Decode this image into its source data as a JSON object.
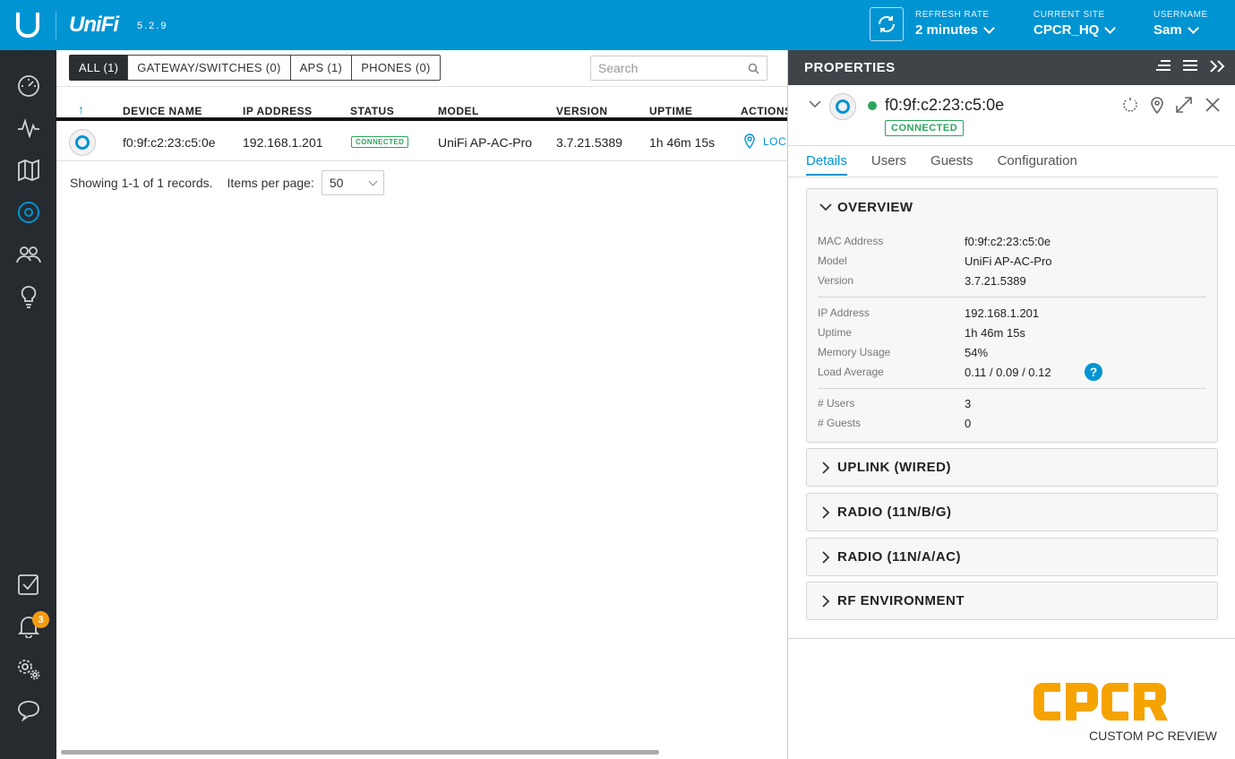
{
  "app": {
    "brand": "UniFi",
    "version": "5.2.9"
  },
  "header": {
    "refresh": {
      "label": "REFRESH RATE",
      "value": "2 minutes"
    },
    "site": {
      "label": "CURRENT SITE",
      "value": "CPCR_HQ"
    },
    "user": {
      "label": "USERNAME",
      "value": "Sam"
    }
  },
  "sidebar": {
    "items": [
      "dashboard-icon",
      "statistics-icon",
      "map-icon",
      "devices-icon",
      "clients-icon",
      "insights-icon"
    ],
    "bottom_items": [
      "events-icon",
      "alerts-icon",
      "settings-icon",
      "support-chat-icon"
    ],
    "alert_count": "3",
    "active_color": "#0194d3"
  },
  "devices": {
    "filters": [
      "ALL (1)",
      "GATEWAY/SWITCHES (0)",
      "APS (1)",
      "PHONES (0)"
    ],
    "search_placeholder": "Search",
    "columns": [
      "DEVICE NAME",
      "IP ADDRESS",
      "STATUS",
      "MODEL",
      "VERSION",
      "UPTIME",
      "ACTIONS"
    ],
    "rows": [
      {
        "name": "f0:9f:c2:23:c5:0e",
        "ip": "192.168.1.201",
        "status": "CONNECTED",
        "model": "UniFi AP-AC-Pro",
        "version": "3.7.21.5389",
        "uptime": "1h 46m 15s",
        "action": "LOC"
      }
    ],
    "showing": "Showing 1-1 of 1 records.",
    "items_per_page_label": "Items per page:",
    "items_per_page": "50"
  },
  "properties": {
    "title": "PROPERTIES",
    "device_name": "f0:9f:c2:23:c5:0e",
    "status": "CONNECTED",
    "status_color": "#2ca55c",
    "tabs": [
      "Details",
      "Users",
      "Guests",
      "Configuration"
    ],
    "active_tab": "Details",
    "overview": {
      "title": "OVERVIEW",
      "rows": [
        {
          "k": "MAC Address",
          "v": "f0:9f:c2:23:c5:0e"
        },
        {
          "k": "Model",
          "v": "UniFi AP-AC-Pro"
        },
        {
          "k": "Version",
          "v": "3.7.21.5389"
        },
        {
          "k": "IP Address",
          "v": "192.168.1.201"
        },
        {
          "k": "Uptime",
          "v": "1h 46m 15s"
        },
        {
          "k": "Memory Usage",
          "v": "54%"
        },
        {
          "k": "Load Average",
          "v": "0.11 / 0.09 / 0.12"
        },
        {
          "k": "# Users",
          "v": "3"
        },
        {
          "k": "# Guests",
          "v": "0"
        }
      ]
    },
    "sections": [
      "UPLINK (WIRED)",
      "RADIO (11N/B/G)",
      "RADIO (11N/A/AC)",
      "RF ENVIRONMENT"
    ]
  },
  "watermark": {
    "logo": "CPCR",
    "caption": "CUSTOM PC REVIEW"
  }
}
